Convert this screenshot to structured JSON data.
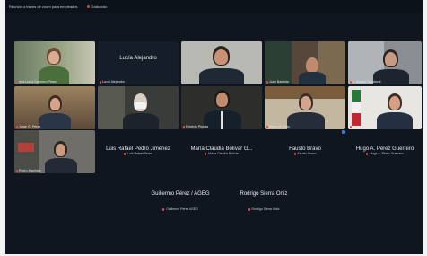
{
  "topbar": {
    "title": "Reunión a ​​través de zoom para empleados",
    "recording_label": "Grabando"
  },
  "tiles": [
    {
      "name": "Ana Lucía Guerrero Pérez"
    },
    {
      "name": "Lucía Alejandro",
      "subname": "Lucía Alejandro"
    },
    {
      "name": ""
    },
    {
      "name": "Juan Bautista"
    },
    {
      "name": "L. Aragón Sandoval"
    },
    {
      "name": "Jorge G. Pérez"
    },
    {
      "name": ""
    },
    {
      "name": "Roberto Pineda"
    },
    {
      "name": "Víctor M. Ortiz"
    },
    {
      "name": "Héctor Fonseca"
    },
    {
      "name": "Pedro Martínez"
    }
  ],
  "name_only": [
    {
      "name": "Luis Rafael Pedro Jiménez",
      "sub": "Luis Rafael Pedro"
    },
    {
      "name": "María Claudia Bolívar G...",
      "sub": "María Claudia Bolívar"
    },
    {
      "name": "Fausto Bravo",
      "sub": "Fausto Bravo"
    },
    {
      "name": "Hugo A. Pérez Guerrero",
      "sub": "Hugo A. Pérez Guerrero"
    },
    {
      "name": "Guillermo Pérez / AGEG",
      "sub": "Guillermo Pérez ASEG"
    },
    {
      "name": "Rodrigo Sierra Ortiz",
      "sub": "Rodrigo Sierra Ortiz"
    }
  ],
  "colors": {
    "background": "#0f1620",
    "muted_mic": "#e84b4b"
  }
}
